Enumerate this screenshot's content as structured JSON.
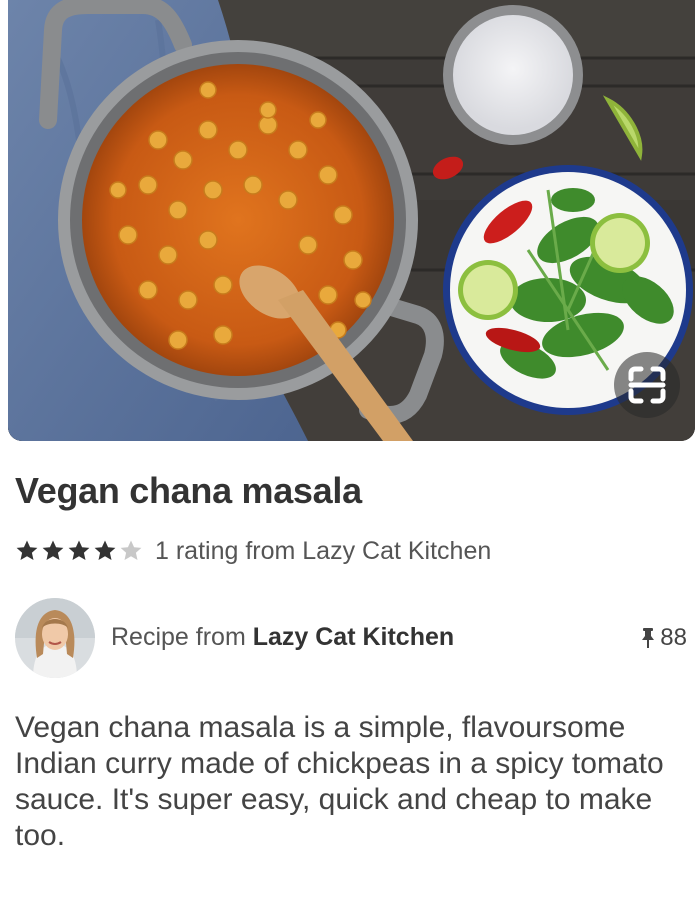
{
  "pin": {
    "title": "Vegan chana masala",
    "rating": {
      "stars_filled": 4,
      "stars_total": 5,
      "text": "1 rating from Lazy Cat Kitchen"
    },
    "author": {
      "prefix": "Recipe from ",
      "name": "Lazy Cat Kitchen",
      "saves": "88"
    },
    "description": "Vegan chana masala is a simple, flavoursome Indian curry made of chickpeas in a spicy tomato sauce. It's super easy, quick and cheap to make too."
  },
  "icons": {
    "visual_search": "visual-search-icon",
    "star": "star-icon",
    "pin": "pushpin-icon"
  },
  "colors": {
    "star_filled": "#333333",
    "star_empty": "#c8c8c8",
    "text_primary": "#333333"
  }
}
